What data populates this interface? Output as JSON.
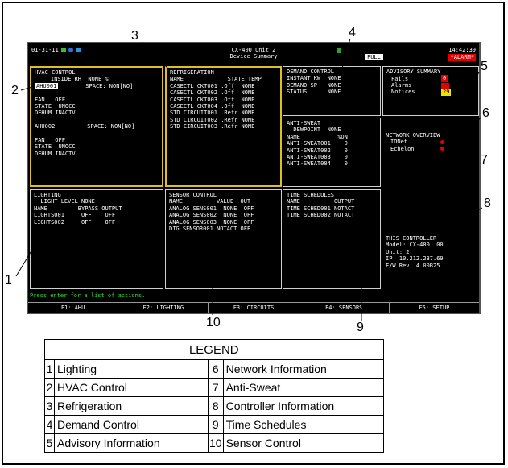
{
  "topbar": {
    "date": "01-31-11",
    "unit": "CX-400 Unit 2",
    "title": "Device Summary",
    "time": "14:42:39",
    "full": "FULL",
    "alarm": "*ALARM*"
  },
  "hvac": {
    "title": "HVAC CONTROL",
    "inside_rh": "INSIDE RH  NONE %",
    "ahu1": "AHU001",
    "space1": "SPACE: NON[NO]",
    "ahu1_rows": [
      "FAN   OFF",
      "STATE  UNOCC",
      "DEHUM INACTV"
    ],
    "ahu2": "AHU002",
    "space2": "SPACE: NON[NO]",
    "ahu2_rows": [
      "FAN   OFF",
      "STATE  UNOCC",
      "DEHUM INACTV"
    ]
  },
  "refrigeration": {
    "title": "REFRIGERATION",
    "header": "NAME             STATE TEMP",
    "rows": [
      "CASECTL CKT001 .Off  NONE",
      "CASECTL CKT002 .Off  NONE",
      "CASECTL CKT003 .Off  NONE",
      "CASECTL CKT004 .Off  NONE",
      "STD CIRCUIT001 .Refr NONE",
      "STD CIRCUIT002 .Refr NONE",
      "STD CIRCUIT003 .Refr NONE"
    ]
  },
  "demand": {
    "title": "DEMAND CONTROL",
    "rows": [
      "INSTANT KW  NONE",
      "DEMAND SP   NONE",
      "STATUS      NONE"
    ]
  },
  "antisweat": {
    "title": "ANTI-SWEAT",
    "dewpoint": "  DEWPOINT  NONE",
    "header": "NAME           %ON",
    "rows": [
      "ANTI-SWEAT001    0",
      "ANTI-SWEAT002    0",
      "ANTI-SWEAT003    0",
      "ANTI-SWEAT004    0"
    ]
  },
  "advisory": {
    "title": "ADVISORY SUMMARY",
    "fails": "Fails",
    "alarms": "Alarms",
    "notices": "Notices",
    "fails_value": "0",
    "notices_value": "29"
  },
  "network": {
    "title": "NETWORK OVERVIEW",
    "items": [
      "IONet",
      "Echelon"
    ]
  },
  "lighting": {
    "title": "LIGHTING",
    "light_level": "  LIGHT LEVEL NONE",
    "header": "NAME         BYPASS OUTPUT",
    "rows": [
      "LIGHTS001     OFF    OFF",
      "LIGHTS002     OFF    OFF"
    ]
  },
  "sensor": {
    "title": "SENSOR CONTROL",
    "header": "NAME          VALUE  OUT",
    "rows": [
      "ANALOG SENS001  NONE  OFF",
      "ANALOG SENS002  NONE  OFF",
      "ANALOG SENS003  NONE  OFF",
      "DIG SENSOR001 NOTACT OFF"
    ]
  },
  "time": {
    "title": "TIME SCHEDULES",
    "header": "NAME          OUTPUT",
    "rows": [
      "TIME SCHED001 NOTACT",
      "TIME SCHED002 NOTACT"
    ]
  },
  "controller": {
    "title": "THIS CONTROLLER",
    "rows": [
      "Model: CX-400  00",
      "Unit: 2",
      "IP: 10.212.237.69",
      "F/W Rev: 4.00B25"
    ]
  },
  "status_line": "Press enter for a list of actions.",
  "fkeys": [
    "F1: AHU",
    "F2: LIGHTING",
    "F3: CIRCUITS",
    "F4: SENSORS",
    "F5: SETUP"
  ],
  "callouts": [
    "1",
    "2",
    "3",
    "4",
    "5",
    "6",
    "7",
    "8",
    "9",
    "10"
  ],
  "legend": {
    "title": "LEGEND",
    "rows": [
      {
        "ln": "1",
        "lt": "Lighting",
        "rn": "6",
        "rt": "Network Information"
      },
      {
        "ln": "2",
        "lt": "HVAC Control",
        "rn": "7",
        "rt": "Anti-Sweat"
      },
      {
        "ln": "3",
        "lt": "Refrigeration",
        "rn": "8",
        "rt": "Controller Information"
      },
      {
        "ln": "4",
        "lt": "Demand Control",
        "rn": "9",
        "rt": "Time Schedules"
      },
      {
        "ln": "5",
        "lt": "Advisory Information",
        "rn": "10",
        "rt": "Sensor Control"
      }
    ]
  }
}
